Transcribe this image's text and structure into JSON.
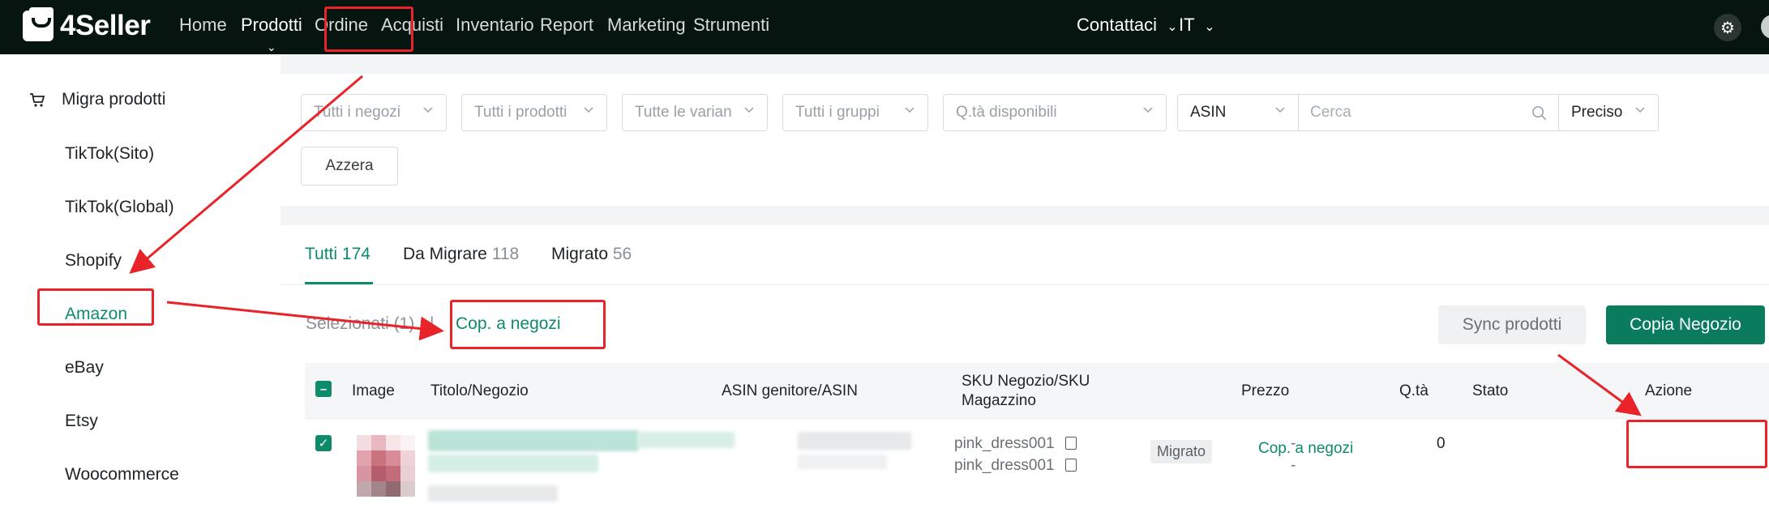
{
  "brand": {
    "name": "4Seller"
  },
  "nav": {
    "items": [
      "Home",
      "Prodotti",
      "Ordine",
      "Acquisti",
      "Inventario",
      "Report",
      "Marketing",
      "Strumenti"
    ],
    "active": "Prodotti",
    "contact": "Contattaci",
    "language": "IT"
  },
  "sidebar": {
    "section": "Migra prodotti",
    "items": [
      "TikTok(Sito)",
      "TikTok(Global)",
      "Shopify",
      "Amazon",
      "eBay",
      "Etsy",
      "Woocommerce"
    ],
    "active": "Amazon"
  },
  "filters": {
    "shops": "Tutti i negozi",
    "products": "Tutti i prodotti",
    "variants": "Tutte le varian",
    "groups": "Tutti i gruppi",
    "qty": "Q.tà disponibili",
    "field": "ASIN",
    "search_placeholder": "Cerca",
    "match": "Preciso",
    "reset": "Azzera"
  },
  "tabs": [
    {
      "label": "Tutti",
      "count": "174"
    },
    {
      "label": "Da Migrare",
      "count": "118"
    },
    {
      "label": "Migrato",
      "count": "56"
    }
  ],
  "toolbar": {
    "selected": "Selezionati (1)",
    "separator": "|",
    "bulk_copy": "Cop. a negozi",
    "sync": "Sync prodotti",
    "copy_shop": "Copia Negozio"
  },
  "table": {
    "columns": {
      "image": "Image",
      "title": "Titolo/Negozio",
      "asin": "ASIN genitore/ASIN",
      "sku_line1": "SKU Negozio/SKU",
      "sku_line2": "Magazzino",
      "price": "Prezzo",
      "qty": "Q.tà",
      "status": "Stato",
      "action": "Azione"
    },
    "rows": [
      {
        "sku_shop": "pink_dress001",
        "sku_warehouse": "pink_dress001",
        "price_1": "-",
        "price_2": "-",
        "qty": "0",
        "status": "Migrato",
        "action": "Cop. a negozi"
      }
    ]
  },
  "colors": {
    "accent": "#0d8b6a",
    "primary_button": "#0b7b5e",
    "nav_bg": "#061510",
    "annotation": "#e8242a"
  }
}
